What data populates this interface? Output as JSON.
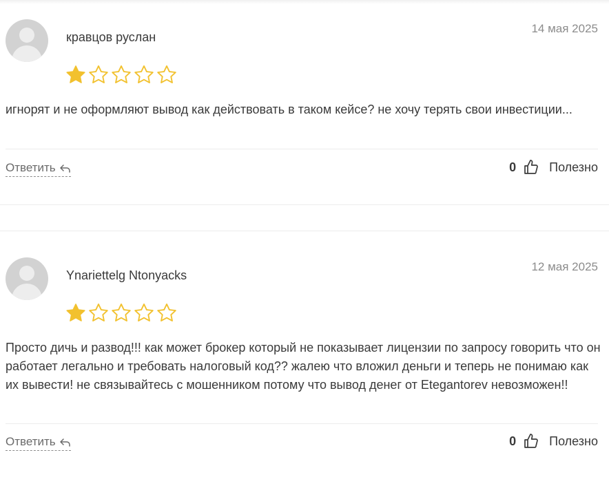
{
  "colors": {
    "star_filled": "#f2c12e",
    "star_empty_outline": "#f2c12e",
    "text": "#3a3a3a",
    "date": "#8c8c8c"
  },
  "reviews": [
    {
      "author": "кравцов руслан",
      "date": "14 мая 2025",
      "rating": 1,
      "max_rating": 5,
      "text": "игнорят и не оформляют вывод как действовать в таком кейсе? не хочу терять свои инвестиции...",
      "reply_label": "Ответить",
      "helpful_count": "0",
      "helpful_label": "Полезно"
    },
    {
      "author": "Ynariettelg Ntonyacks",
      "date": "12 мая 2025",
      "rating": 1,
      "max_rating": 5,
      "text": "Просто дичь и развод!!! как может брокер который не показывает лицензии по запросу говорить что он работает легально и требовать налоговый код?? жалею что вложил деньги и теперь не понимаю как их вывести! не связывайтесь с мошенником потому что вывод денег от Etegantorev невозможен!!",
      "reply_label": "Ответить",
      "helpful_count": "0",
      "helpful_label": "Полезно"
    }
  ]
}
